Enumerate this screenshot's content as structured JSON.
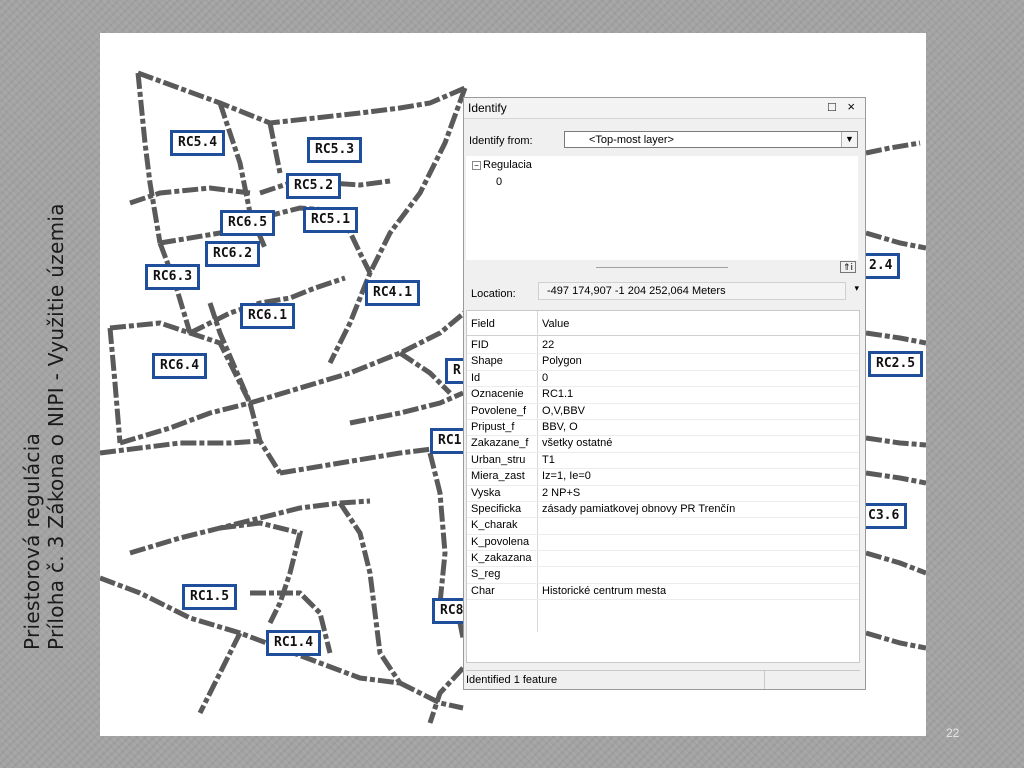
{
  "slide": {
    "title_line1": "Priestorová regulácia",
    "title_line2": "Príloha č. 3 Zákona o NIPI - Využitie územia",
    "page_number": "22"
  },
  "map": {
    "labels": [
      "RC5.4",
      "RC5.3",
      "RC5.2",
      "RC5.1",
      "RC6.5",
      "RC6.2",
      "RC6.3",
      "RC6.1",
      "RC4.1",
      "RC6.4",
      "RC1.5",
      "RC1.4",
      "2.4",
      "RC2.5",
      "C3.6",
      "R",
      "RC1",
      "RC8"
    ],
    "border_color": "#1f4e9a"
  },
  "identify": {
    "title": "Identify",
    "controls": "□ ×",
    "identify_from_label": "Identify from:",
    "identify_from_value": "<Top-most layer>",
    "tree_layer": "Regulacia",
    "tree_feature": "0",
    "location_label": "Location:",
    "location_value": "-497 174,907  -1 204 252,064 Meters",
    "columns": [
      "Field",
      "Value"
    ],
    "rows": [
      {
        "field": "FID",
        "value": "22"
      },
      {
        "field": "Shape",
        "value": "Polygon"
      },
      {
        "field": "Id",
        "value": "0"
      },
      {
        "field": "Oznacenie",
        "value": "RC1.1"
      },
      {
        "field": "Povolene_f",
        "value": "O,V,BBV"
      },
      {
        "field": "Pripust_f",
        "value": "BBV, O"
      },
      {
        "field": "Zakazane_f",
        "value": "všetky ostatné"
      },
      {
        "field": "Urban_stru",
        "value": "T1"
      },
      {
        "field": "Miera_zast",
        "value": "Iz=1, Ie=0"
      },
      {
        "field": "Vyska",
        "value": "2 NP+S"
      },
      {
        "field": "Specificka",
        "value": "zásady pamiatkovej obnovy PR Trenčín"
      },
      {
        "field": "K_charak",
        "value": ""
      },
      {
        "field": "K_povolena",
        "value": ""
      },
      {
        "field": "K_zakazana",
        "value": ""
      },
      {
        "field": "S_reg",
        "value": ""
      },
      {
        "field": "Char",
        "value": "Historické centrum mesta"
      }
    ],
    "status": "Identified 1 feature"
  }
}
